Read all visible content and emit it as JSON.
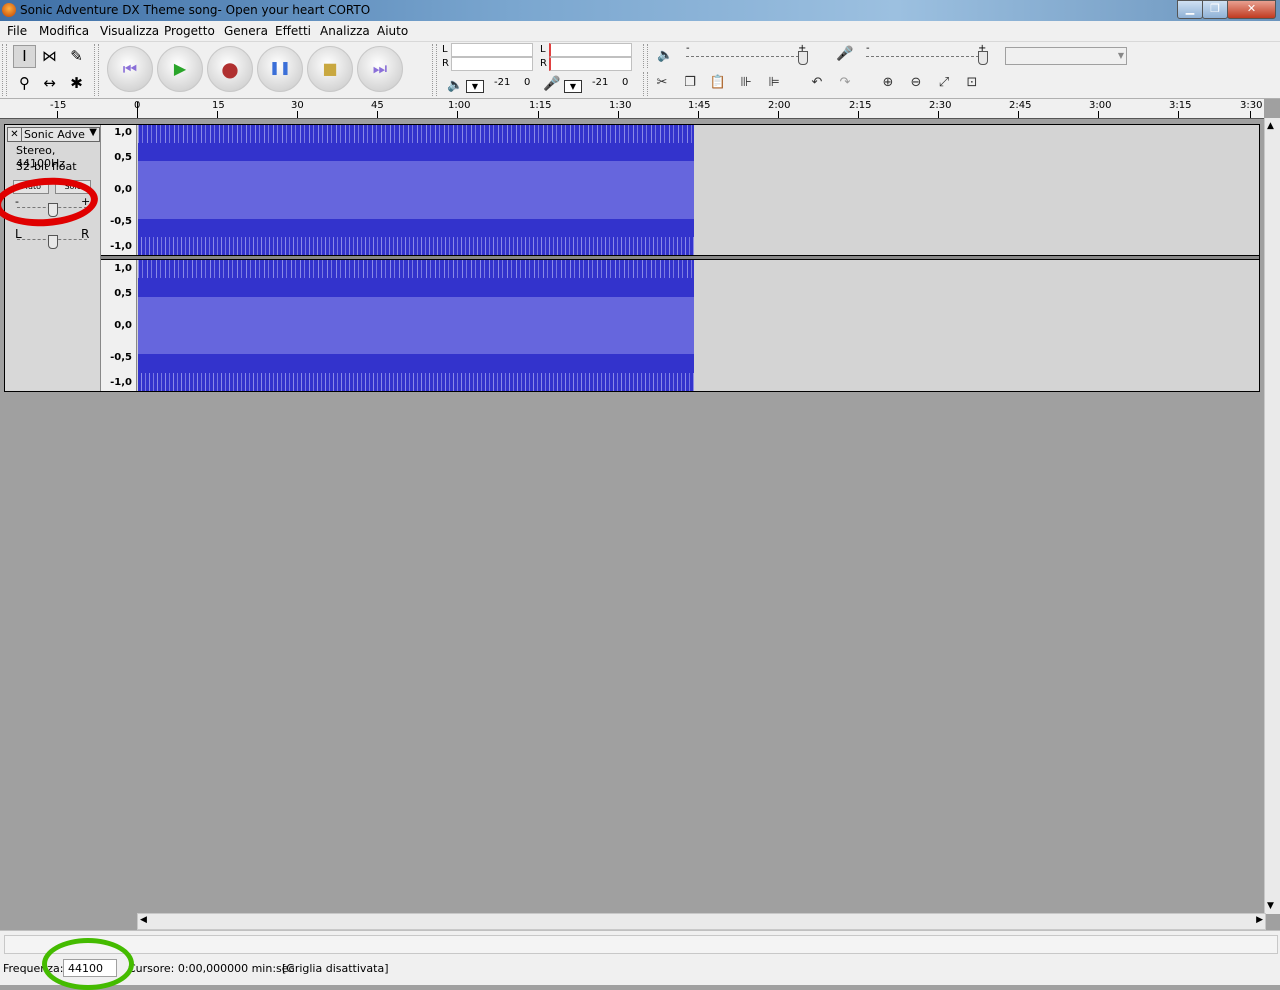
{
  "window": {
    "title": "Sonic Adventure DX Theme song- Open your heart CORTO",
    "controls": {
      "minimize": "▁",
      "maximize": "❐",
      "close": "✕"
    }
  },
  "menu": [
    "File",
    "Modifica",
    "Visualizza",
    "Progetto",
    "Genera",
    "Effetti",
    "Analizza",
    "Aiuto"
  ],
  "tools": {
    "selection_icon": "I",
    "envelope_icon": "⋈",
    "draw_icon": "✎",
    "zoom_icon": "⚲",
    "timeshift_icon": "↔",
    "multi_icon": "✱"
  },
  "transport": {
    "skip_start_icon": "⏮",
    "play_icon": "▶",
    "record_icon": "●",
    "pause_icon": "❚❚",
    "stop_icon": "■",
    "skip_end_icon": "⏭"
  },
  "meters": {
    "play": {
      "l": "L",
      "r": "R",
      "db_low": "-21",
      "db_zero": "0"
    },
    "record": {
      "l": "L",
      "r": "R",
      "db_low": "-21",
      "db_zero": "0"
    }
  },
  "mixer": {
    "output_minus": "-",
    "output_plus": "+",
    "input_minus": "-",
    "input_plus": "+",
    "input_source": ""
  },
  "edit": {
    "cut_icon": "✂",
    "copy_icon": "❐",
    "paste_icon": "📋",
    "trim_icon": "⊪",
    "silence_icon": "⊫",
    "undo_icon": "↶",
    "redo_icon": "↷",
    "zoom_in_icon": "⊕",
    "zoom_out_icon": "⊖",
    "fit_selection_icon": "⤢",
    "fit_project_icon": "⊡"
  },
  "ruler": {
    "labels": [
      "-15",
      "0",
      "15",
      "30",
      "45",
      "1:00",
      "1:15",
      "1:30",
      "1:45",
      "2:00",
      "2:15",
      "2:30",
      "2:45",
      "3:00",
      "3:15",
      "3:30"
    ]
  },
  "track": {
    "close_icon": "✕",
    "name": "Sonic Adve",
    "dropdown_icon": "▼",
    "info1": "Stereo, 44100Hz",
    "info2": "32-bit float",
    "mute_label": "Muto",
    "solo_label": "Solo",
    "gain_minus": "-",
    "gain_plus": "+",
    "pan_left": "L",
    "pan_right": "R",
    "gain_level": 0.45,
    "pan_level": 0.5,
    "scale_ch1": [
      "1,0",
      "0,5",
      "0,0",
      "-0,5",
      "-1,0"
    ],
    "scale_ch2": [
      "1,0",
      "0,5",
      "0,0",
      "-0,5",
      "-1,0"
    ]
  },
  "scroll": {
    "up": "▲",
    "down": "▼",
    "left": "◀",
    "right": "▶"
  },
  "status": {
    "rate_label": "Frequenza:",
    "rate_value": "44100",
    "cursor": "Cursore: 0:00,000000 min:sec",
    "snap": "[Griglia disattivata]"
  },
  "colors": {
    "waveform": "#3333cc",
    "waveform_rms": "#6666dd",
    "annotation_red": "#e00000",
    "annotation_green": "#44bb00"
  }
}
